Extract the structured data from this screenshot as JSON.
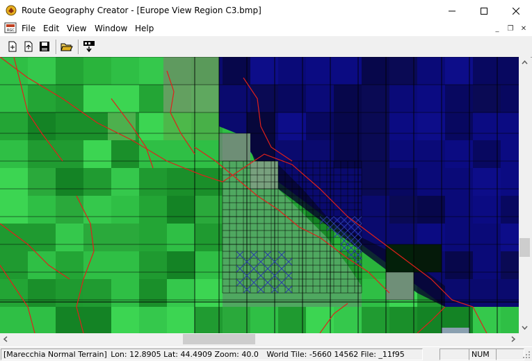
{
  "window": {
    "title": "Route Geography Creator - [Europe View Region C3.bmp]",
    "minimize_glyph": "—",
    "maximize_glyph": "☐",
    "close_glyph": "✕"
  },
  "menu": {
    "items": [
      "File",
      "Edit",
      "View",
      "Window",
      "Help"
    ],
    "mdi_minimize": "_",
    "mdi_restore": "❐",
    "mdi_close": "✕"
  },
  "toolbar": {
    "buttons": [
      "new-file-icon",
      "open-add-icon",
      "save-icon",
      "open-folder-icon",
      "import-tile-icon"
    ]
  },
  "map": {
    "colors": {
      "land_bright": "#2fc24a",
      "land_dark": "#0f7a1f",
      "sea": "#0b0b7a",
      "sea_dark": "#0a0a3a",
      "grid": "#000000",
      "route": "#e0201a",
      "hatch": "#2a3aa8"
    }
  },
  "status": {
    "region": "[Marecchia Normal Terrain]",
    "coords": "Lon: 12.8905 Lat: 44.4909 Zoom: 40.0",
    "world_tile": "World Tile: -5660 14562  File: _11f95",
    "num": "NUM"
  }
}
